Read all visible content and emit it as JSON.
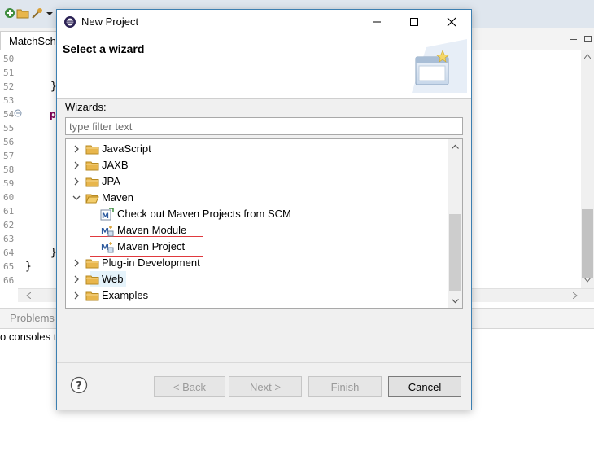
{
  "ide": {
    "editor_tab_label": "MatchSche",
    "line_numbers": [
      "50",
      "51",
      "52",
      "53",
      "54",
      "55",
      "56",
      "57",
      "58",
      "59",
      "60",
      "61",
      "62",
      "63",
      "64",
      "65",
      "66"
    ],
    "code_fragments": {
      "brace_52": "}",
      "kw_54": "p",
      "brace_64": "}",
      "brace_65": "}"
    },
    "problems_tab_label": "Problems",
    "console_text": "o consoles t"
  },
  "dialog": {
    "title": "New Project",
    "header_title": "Select a wizard",
    "wizards_label": "Wizards:",
    "filter_placeholder": "type filter text",
    "tree": [
      {
        "label": "JavaScript",
        "expanded": false
      },
      {
        "label": "JAXB",
        "expanded": false
      },
      {
        "label": "JPA",
        "expanded": false
      },
      {
        "label": "Maven",
        "expanded": true
      },
      {
        "label": "Check out Maven Projects from SCM"
      },
      {
        "label": "Maven Module"
      },
      {
        "label": "Maven Project",
        "highlighted": true
      },
      {
        "label": "Plug-in Development",
        "expanded": false
      },
      {
        "label": "Web",
        "expanded": false,
        "hover": true
      },
      {
        "label": "Examples",
        "expanded": false
      }
    ],
    "buttons": {
      "back": "< Back",
      "next": "Next >",
      "finish": "Finish",
      "cancel": "Cancel"
    }
  },
  "colors": {
    "accent_border": "#3c7fb1",
    "highlight_red": "#e0393e",
    "folder": "#e8b64c",
    "hover": "#e5f3fb"
  }
}
